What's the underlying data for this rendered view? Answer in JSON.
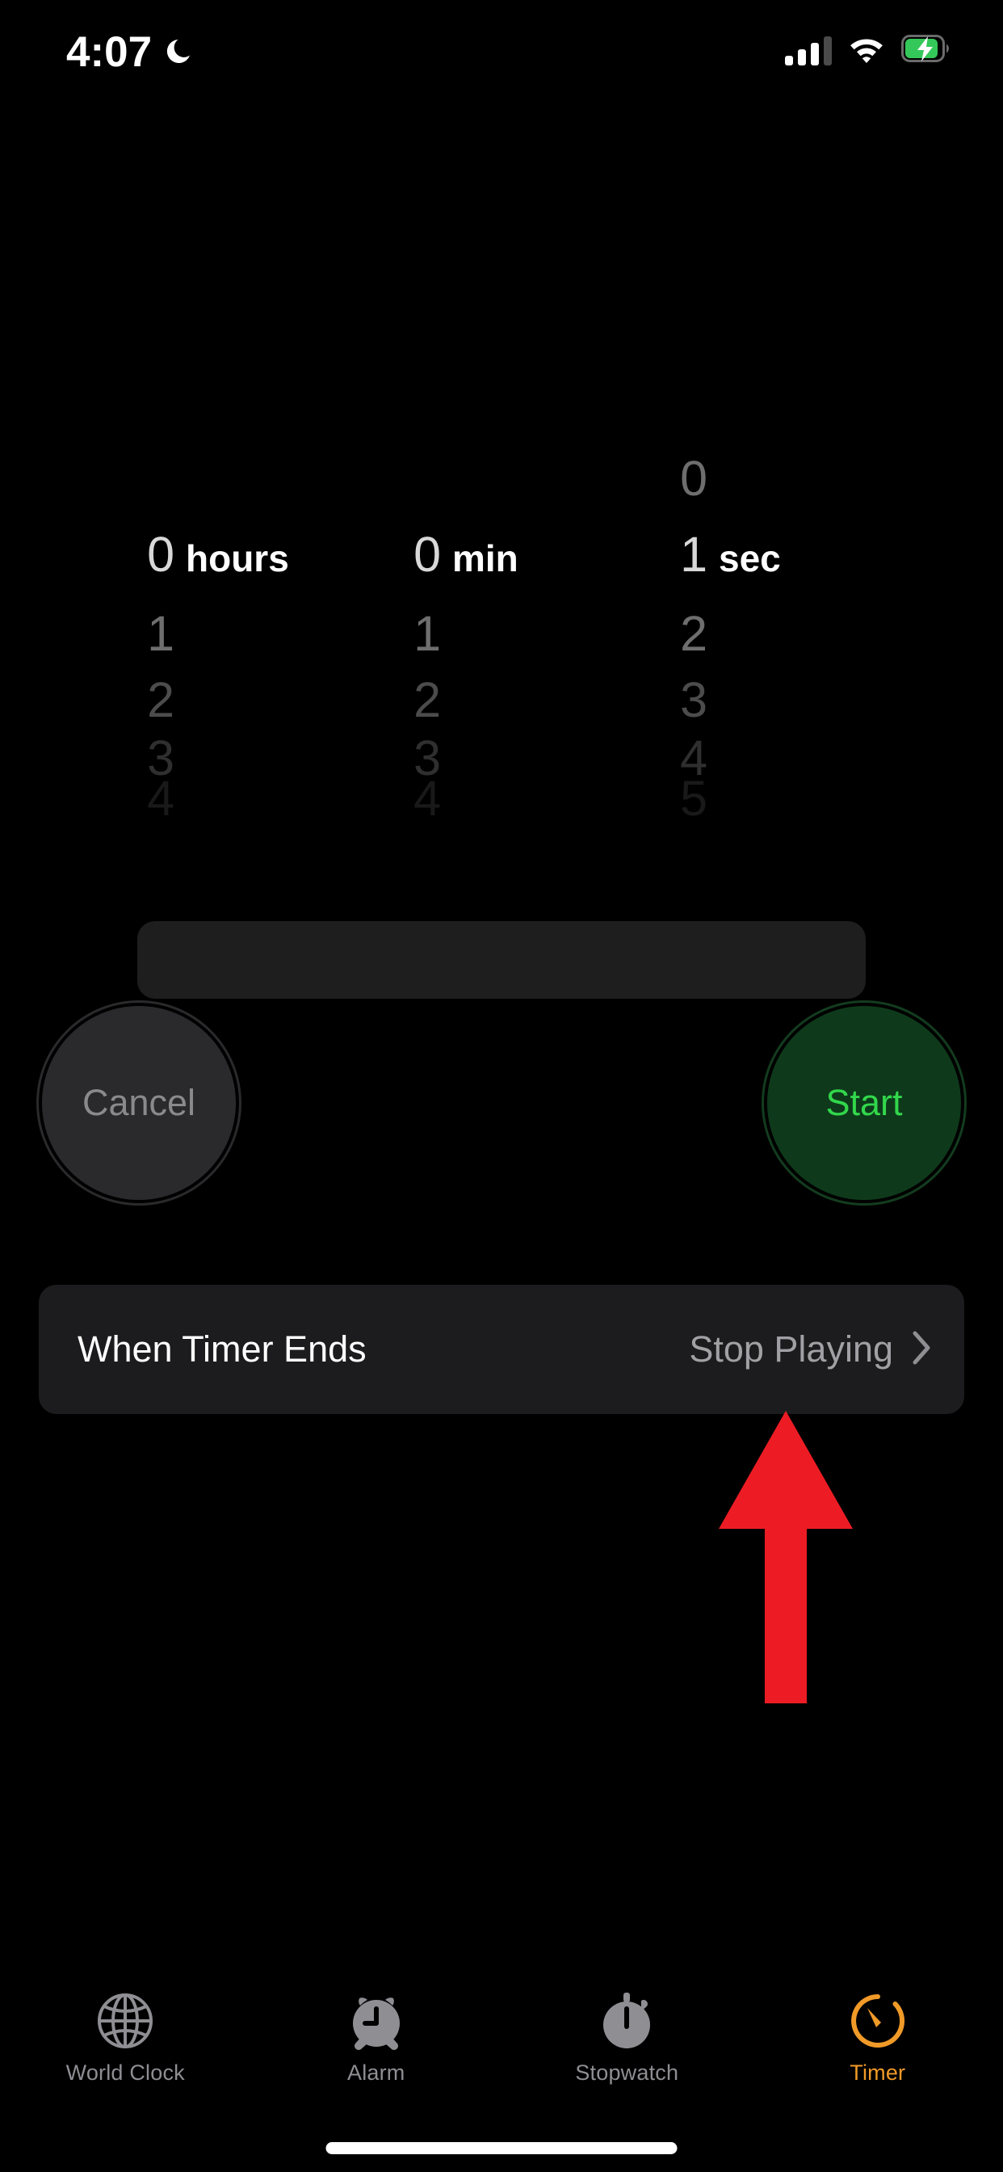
{
  "status_bar": {
    "time": "4:07",
    "dnd_icon": "crescent-moon-icon",
    "signal_icon": "cellular-signal-icon",
    "signal_bars_filled": 3,
    "signal_bars_total": 4,
    "wifi_icon": "wifi-icon",
    "battery_icon": "battery-charging-icon",
    "battery_charging": true,
    "battery_color": "#34c759"
  },
  "picker": {
    "hours": {
      "unit_label": "hours",
      "selected": "0",
      "above": [],
      "below": [
        "1",
        "2",
        "3",
        "4"
      ]
    },
    "minutes": {
      "unit_label": "min",
      "selected": "0",
      "above": [],
      "below": [
        "1",
        "2",
        "3",
        "4"
      ]
    },
    "seconds": {
      "unit_label": "sec",
      "selected": "1",
      "above": [
        "0"
      ],
      "below": [
        "2",
        "3",
        "4",
        "5"
      ]
    }
  },
  "actions": {
    "cancel_label": "Cancel",
    "start_label": "Start",
    "start_color": "#32d74b"
  },
  "when_timer_ends": {
    "label": "When Timer Ends",
    "value": "Stop Playing",
    "chevron_icon": "chevron-right-icon"
  },
  "annotation": {
    "arrow_icon": "up-arrow-icon",
    "arrow_color": "#ed1c24",
    "points_at": "when-timer-ends-row"
  },
  "tab_bar": {
    "active": "Timer",
    "active_color": "#f09a28",
    "inactive_color": "#8e8e93",
    "items": [
      {
        "label": "World Clock",
        "icon": "globe-icon",
        "active": false
      },
      {
        "label": "Alarm",
        "icon": "alarm-clock-icon",
        "active": false
      },
      {
        "label": "Stopwatch",
        "icon": "stopwatch-icon",
        "active": false
      },
      {
        "label": "Timer",
        "icon": "timer-icon",
        "active": true
      }
    ]
  },
  "home_indicator": "home-indicator"
}
